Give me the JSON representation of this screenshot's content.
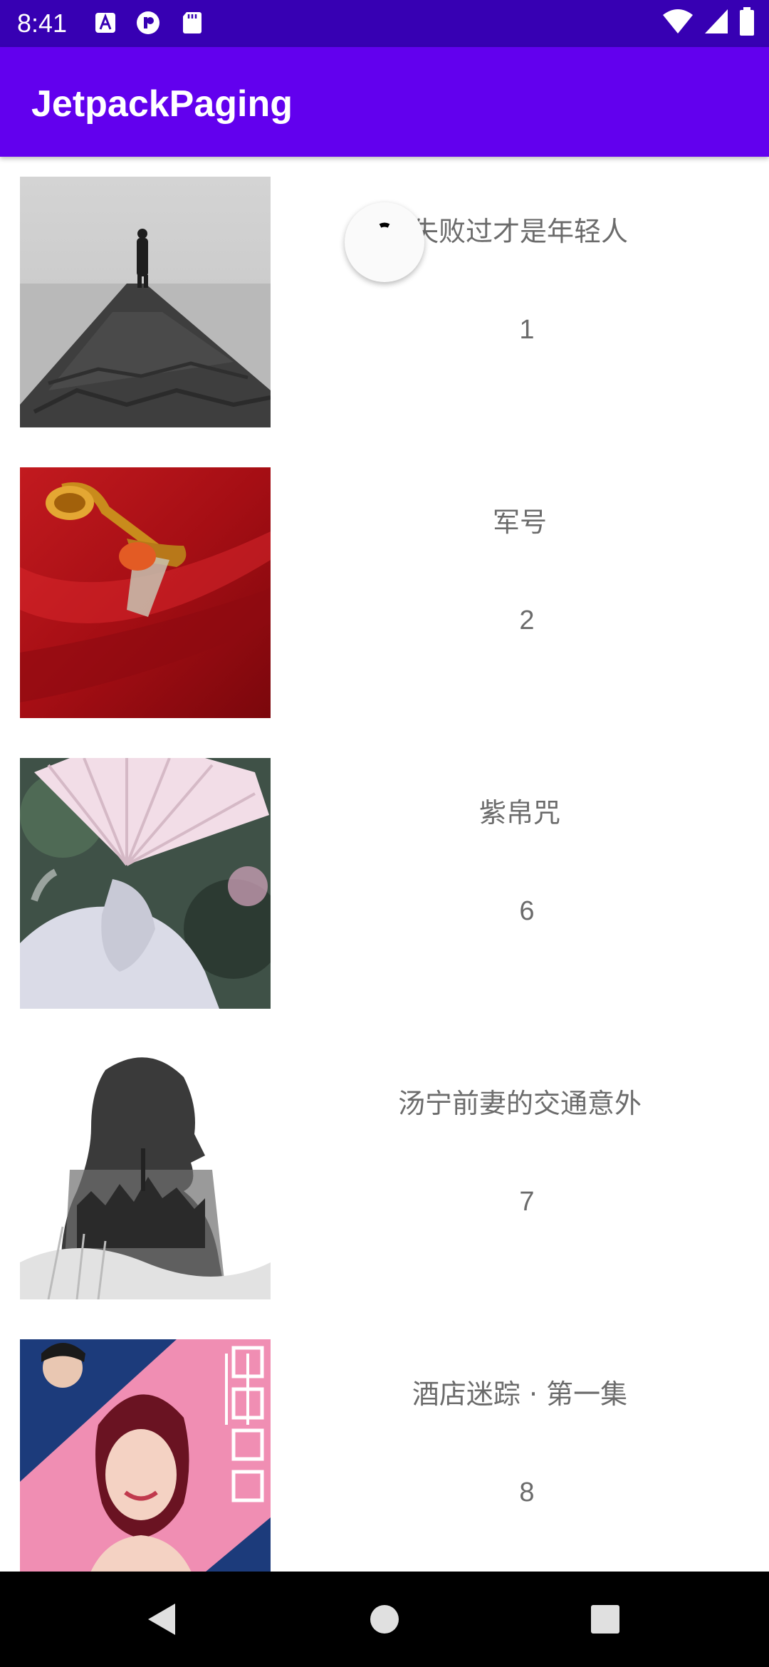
{
  "status_bar": {
    "time": "8:41",
    "icons_left": [
      "a11y-icon",
      "recorder-icon",
      "sdcard-icon"
    ],
    "icons_right": [
      "wifi-icon",
      "cell-signal-icon",
      "battery-icon"
    ]
  },
  "app_bar": {
    "title": "JetpackPaging",
    "color": "#6200ee",
    "status_color": "#3700b3"
  },
  "list": {
    "items": [
      {
        "title": "失败过才是年轻人",
        "number": "1",
        "image": "man-on-stone-pier-image"
      },
      {
        "title": "军号",
        "number": "2",
        "image": "bugle-on-red-cloth-image"
      },
      {
        "title": "紫帛咒",
        "number": "6",
        "image": "woman-with-fan-image"
      },
      {
        "title": "汤宁前妻的交通意外",
        "number": "7",
        "image": "silhouette-city-double-exposure-image"
      },
      {
        "title": "酒店迷踪 · 第一集",
        "number": "8",
        "image": "hotel-poster-image"
      }
    ]
  },
  "refresh_indicator": {
    "icon": "swipe-refresh-spinner-icon"
  },
  "nav_bar": {
    "buttons": [
      "back-icon",
      "home-icon",
      "recents-icon"
    ]
  }
}
